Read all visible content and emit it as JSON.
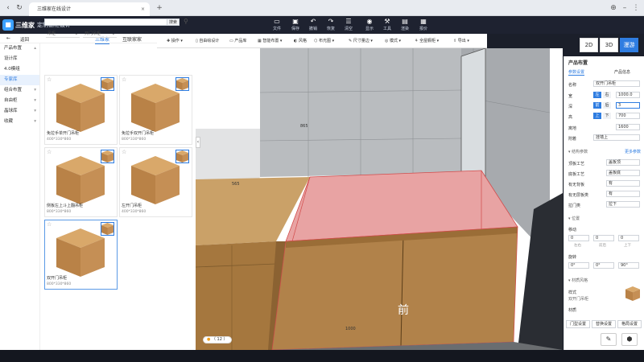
{
  "browser": {
    "tab_title": "三维家在线设计",
    "close": "×",
    "add": "+",
    "extension_icon": "⊕",
    "menu_icon": "⋮"
  },
  "header": {
    "brand": "三维家",
    "sub": "定制橱柜设计",
    "tools": [
      {
        "icon": "file-icon",
        "label": "文件"
      },
      {
        "icon": "save-icon",
        "label": "保存"
      },
      {
        "icon": "undo-icon",
        "label": "撤销"
      },
      {
        "icon": "redo-icon",
        "label": "恢复"
      },
      {
        "icon": "list-icon",
        "label": "清空"
      },
      {
        "icon": "eye-icon",
        "label": "显示"
      },
      {
        "icon": "tool-icon",
        "label": "工具"
      },
      {
        "icon": "render-icon",
        "label": "渲染"
      },
      {
        "icon": "pay-icon",
        "label": "报价"
      }
    ]
  },
  "left": {
    "back": "返回",
    "tabs": [
      "三维家",
      "互联家家"
    ],
    "categories": [
      {
        "label": "产品布置",
        "type": "group"
      },
      {
        "label": "设计库",
        "type": "sub"
      },
      {
        "label": "4.0模组",
        "type": "sub"
      },
      {
        "label": "专家库",
        "type": "sub"
      },
      {
        "label": "组合布置",
        "type": "group"
      },
      {
        "label": "自由柜",
        "type": "group"
      },
      {
        "label": "晶球库",
        "type": "group"
      },
      {
        "label": "收藏",
        "type": "group"
      }
    ],
    "search_btn": "搜索",
    "filters": [
      "吊柜",
      "开门吊柜"
    ],
    "cards": [
      {
        "name": "免拉手单开门吊柜",
        "dim": "400*330*860"
      },
      {
        "name": "免拉手双开门吊柜",
        "dim": "800*330*860"
      },
      {
        "name": "侧板左上斗上翻吊柜",
        "dim": "800*330*860"
      },
      {
        "name": "左开门吊柜",
        "dim": "400*330*860"
      },
      {
        "name": "双开门吊柜",
        "dim": "800*330*860"
      }
    ]
  },
  "viewport": {
    "toolbar": [
      "操作",
      "自由绘设计",
      "产品库",
      "智能布置",
      "风格",
      "布光图",
      "尺寸量边",
      "模式",
      "全屋橱柜",
      "导出"
    ],
    "front_label": "前",
    "dims": [
      "865",
      "565",
      "1000"
    ],
    "counter": "（ 12 ）"
  },
  "view_switch": [
    "2D",
    "3D",
    "漫游"
  ],
  "right": {
    "title": "产品布置",
    "tabs": [
      "参数设置",
      "产品信息"
    ],
    "name_label": "名称",
    "name_val": "双开门吊柜",
    "rows": [
      {
        "label": "宽",
        "segs": [
          "左",
          "右"
        ],
        "val": "1000.0"
      },
      {
        "label": "深",
        "segs": [
          "前",
          "后"
        ],
        "val": "3"
      },
      {
        "label": "高",
        "segs": [
          "上",
          "下"
        ],
        "val": "700"
      }
    ],
    "height_label": "离地",
    "height_val": "1600",
    "attach_label": "附着",
    "attach_val": "挂墙上",
    "section1": "结构参数",
    "more": "更多参数",
    "params": [
      {
        "label": "顶板工艺",
        "val": "盖板顶"
      },
      {
        "label": "底板工艺",
        "val": "盖板底"
      },
      {
        "label": "有无背板",
        "val": "有"
      },
      {
        "label": "有无层板类",
        "val": "有"
      },
      {
        "label": "拉门类",
        "val": "拉下"
      }
    ],
    "section2": "位置",
    "move_label": "移动",
    "move_vals": [
      "0",
      "0",
      "0"
    ],
    "move_sub": [
      "左右",
      "前后",
      "上下"
    ],
    "rotate_label": "旋转",
    "rotate_vals": [
      "0°",
      "0°",
      "90°"
    ],
    "section3": "材质风格",
    "style_label": "样式",
    "style_val": "双开门吊柜",
    "material_label": "材质",
    "bottom_btns": [
      "门型设置",
      "替换设置",
      "格局设置"
    ]
  },
  "colors": {
    "accent": "#2f7de1",
    "topbar": "#1e2230"
  }
}
